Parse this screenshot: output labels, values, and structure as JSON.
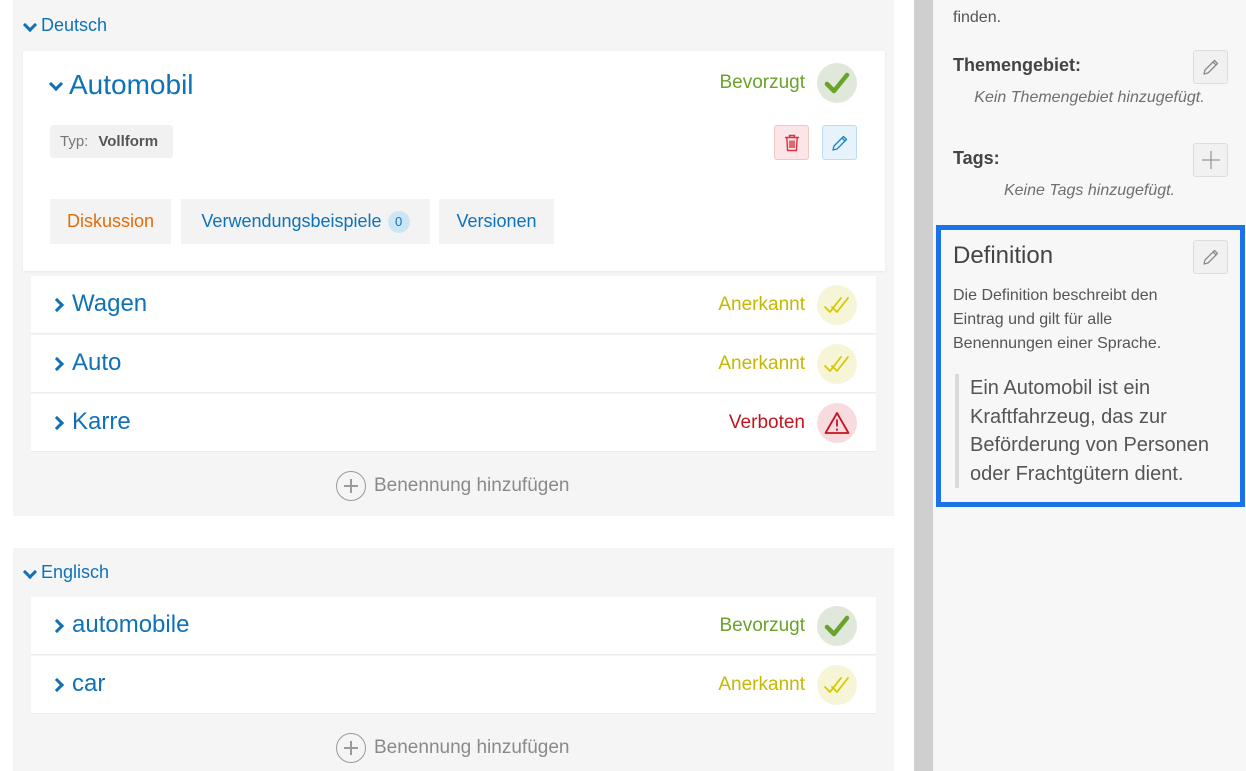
{
  "languages": {
    "german": {
      "label": "Deutsch",
      "expanded_term": {
        "name": "Automobil",
        "status": "Bevorzugt",
        "type_label": "Typ:",
        "type_value": "Vollform",
        "tabs": {
          "discussion": "Diskussion",
          "usage_examples": "Verwendungsbeispiele",
          "usage_count": "0",
          "versions": "Versionen"
        }
      },
      "terms": [
        {
          "name": "Wagen",
          "status": "Anerkannt"
        },
        {
          "name": "Auto",
          "status": "Anerkannt"
        },
        {
          "name": "Karre",
          "status": "Verboten"
        }
      ],
      "add_term_label": "Benennung hinzufügen"
    },
    "english": {
      "label": "Englisch",
      "terms": [
        {
          "name": "automobile",
          "status": "Bevorzugt"
        },
        {
          "name": "car",
          "status": "Anerkannt"
        }
      ],
      "add_term_label": "Benennung hinzufügen"
    }
  },
  "sidebar": {
    "intro_text_tail": "finden.",
    "subject_area": {
      "label": "Themengebiet:",
      "empty": "Kein Themengebiet hinzugefügt."
    },
    "tags": {
      "label": "Tags:",
      "empty": "Keine Tags hinzugefügt."
    },
    "definition": {
      "title": "Definition",
      "description": "Die Definition beschreibt den Eintrag und gilt für alle Benennungen einer Sprache.",
      "text": "Ein Automobil ist ein Kraftfahrzeug, das zur Beförderung von Personen oder Frachtgütern dient."
    }
  },
  "colors": {
    "accent_blue": "#0f72b8",
    "preferred_green": "#6aa22a",
    "admitted_yellow": "#c6b700",
    "forbidden_red": "#c4141f",
    "discussion_orange": "#e36c0a",
    "highlight_border": "#1a73e8"
  },
  "icons": {
    "preferred": "check-icon",
    "admitted": "double-check-icon",
    "forbidden": "warning-triangle-icon",
    "delete": "trash-icon",
    "edit": "pencil-icon",
    "add": "plus-icon"
  }
}
